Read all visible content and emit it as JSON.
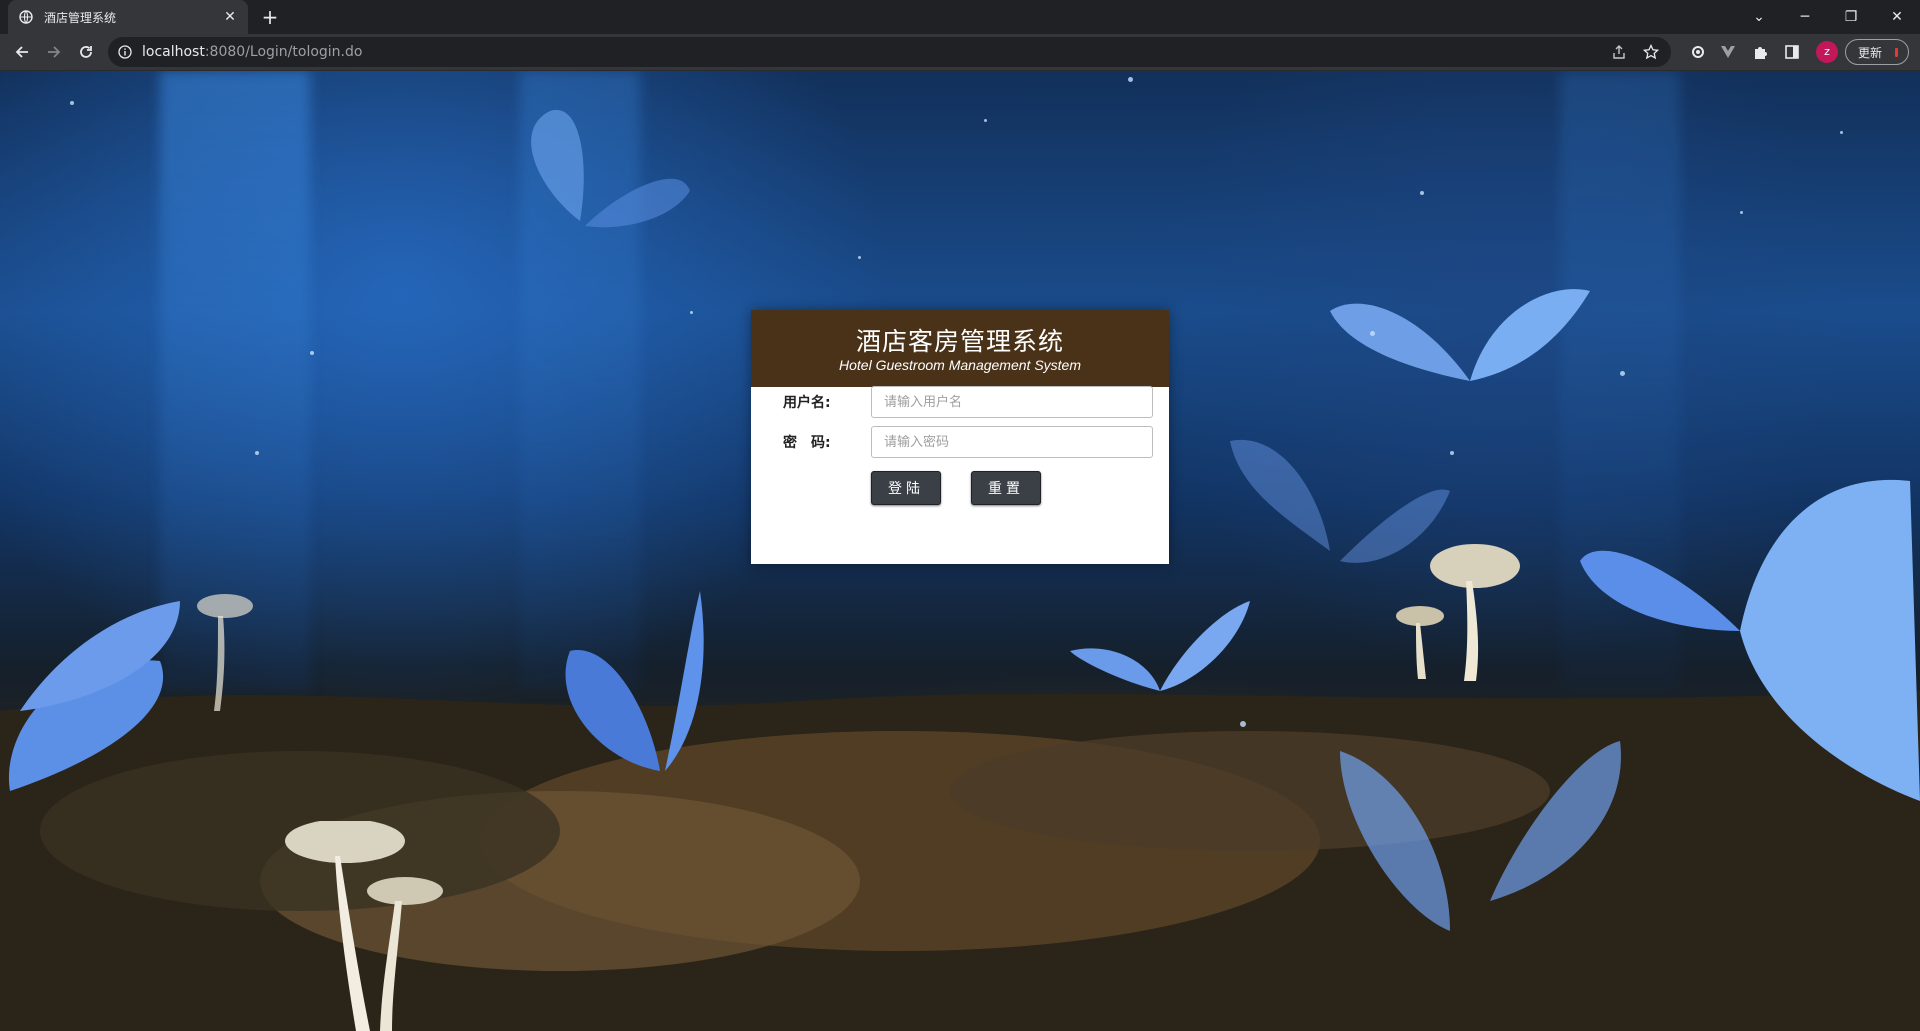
{
  "browser": {
    "tab_title": "酒店管理系统",
    "new_tab_symbol": "+",
    "url_host": "localhost",
    "url_rest": ":8080/Login/tologin.do",
    "profile_initial": "z",
    "update_label": "更新",
    "window_controls": {
      "dropdown": "⌄",
      "minimize": "─",
      "restore": "❐",
      "close": "✕"
    },
    "tab_close": "✕"
  },
  "login": {
    "title": "酒店客房管理系统",
    "subtitle": "Hotel Guestroom Management System",
    "username_label": "用户名:",
    "username_placeholder": "请输入用户名",
    "password_label": "密　码:",
    "password_placeholder": "请输入密码",
    "login_button": "登陆",
    "reset_button": "重置"
  },
  "colors": {
    "header_brown": "#4a3218",
    "button_dark": "#3b4046",
    "chrome_dark": "#202124",
    "chrome_toolbar": "#35363a"
  },
  "icons": [
    "globe-icon",
    "back-icon",
    "forward-icon",
    "reload-icon",
    "info-icon",
    "share-icon",
    "star-icon",
    "extension-gear-icon",
    "vue-devtools-icon",
    "puzzle-icon",
    "sidepanel-icon"
  ]
}
